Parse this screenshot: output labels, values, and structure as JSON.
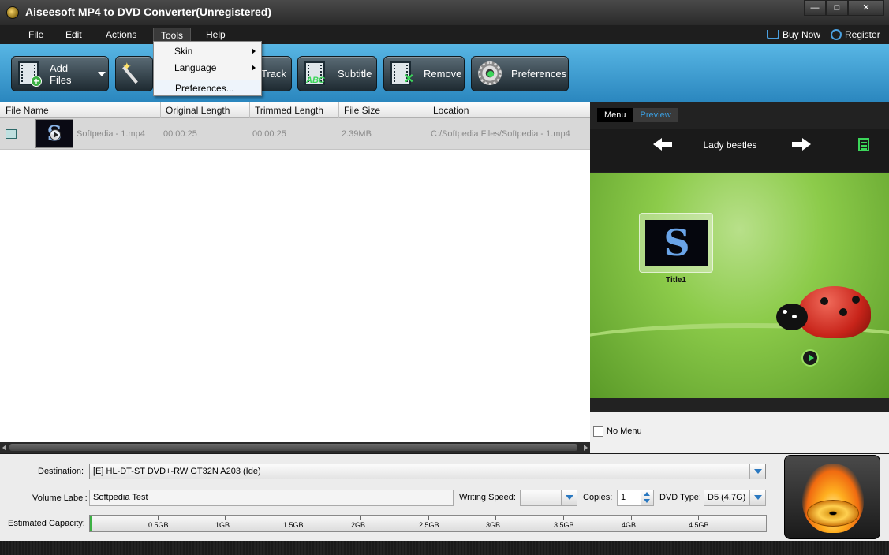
{
  "window": {
    "title": "Aiseesoft MP4 to DVD Converter(Unregistered)",
    "controls": {
      "minimize": "—",
      "maximize": "□",
      "close": "✕"
    }
  },
  "menubar": {
    "items": [
      "File",
      "Edit",
      "Actions",
      "Tools",
      "Help"
    ],
    "active": "Tools",
    "buy_now": "Buy Now",
    "register": "Register"
  },
  "tools_menu": {
    "items": [
      {
        "label": "Skin",
        "submenu": true
      },
      {
        "label": "Language",
        "submenu": true
      },
      {
        "label": "Preferences...",
        "submenu": false
      }
    ],
    "highlighted": "Preferences..."
  },
  "toolbar": {
    "add_files": "Add Files",
    "track_partial": "Track",
    "subtitle": "Subtitle",
    "remove": "Remove",
    "preferences": "Preferences"
  },
  "file_list": {
    "columns": [
      "File Name",
      "Original Length",
      "Trimmed Length",
      "File Size",
      "Location"
    ],
    "rows": [
      {
        "name": "Softpedia - 1.mp4",
        "original_length": "00:00:25",
        "trimmed_length": "00:00:25",
        "file_size": "2.39MB",
        "location": "C:/Softpedia Files/Softpedia - 1.mp4"
      }
    ]
  },
  "menu_panel": {
    "tabs": [
      "Menu",
      "Preview"
    ],
    "active_tab": "Menu",
    "theme_name": "Lady beetles",
    "title_item": "Title1",
    "title_thumb_glyph": "S",
    "no_menu_label": "No Menu",
    "no_menu_checked": false
  },
  "bottom": {
    "destination_label": "Destination:",
    "destination_value": "[E] HL-DT-ST DVD+-RW GT32N A203 (Ide)",
    "volume_label_label": "Volume Label:",
    "volume_label_value": "Softpedia Test",
    "writing_speed_label": "Writing Speed:",
    "writing_speed_value": "",
    "copies_label": "Copies:",
    "copies_value": "1",
    "dvd_type_label": "DVD Type:",
    "dvd_type_value": "D5 (4.7G)",
    "capacity_label": "Estimated Capacity:",
    "capacity_ticks": [
      "0.5GB",
      "1GB",
      "1.5GB",
      "2GB",
      "2.5GB",
      "3GB",
      "3.5GB",
      "4GB",
      "4.5GB"
    ],
    "capacity_used_fraction": 0.003
  },
  "colors": {
    "toolbar_blue": "#3a9ed6",
    "accent_green": "#3cb043",
    "preview_tab_blue": "#3a9ee0"
  }
}
